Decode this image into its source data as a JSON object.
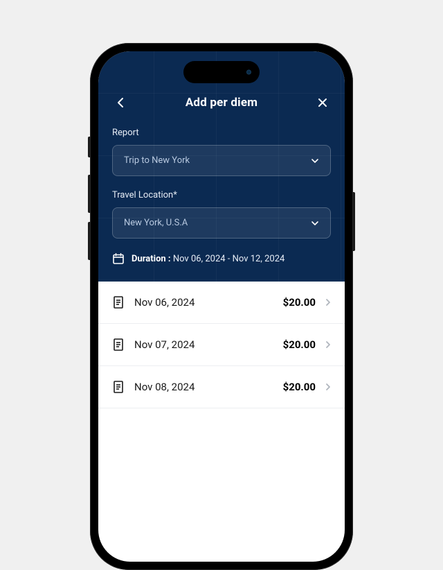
{
  "header": {
    "title": "Add per diem"
  },
  "form": {
    "report": {
      "label": "Report",
      "value": "Trip to New York"
    },
    "location": {
      "label": "Travel Location*",
      "value": "New York, U.S.A"
    },
    "duration": {
      "label": "Duration :",
      "value": "Nov 06, 2024 - Nov 12, 2024"
    }
  },
  "days": [
    {
      "date": "Nov 06, 2024",
      "amount": "$20.00"
    },
    {
      "date": "Nov 07, 2024",
      "amount": "$20.00"
    },
    {
      "date": "Nov 08, 2024",
      "amount": "$20.00"
    }
  ]
}
